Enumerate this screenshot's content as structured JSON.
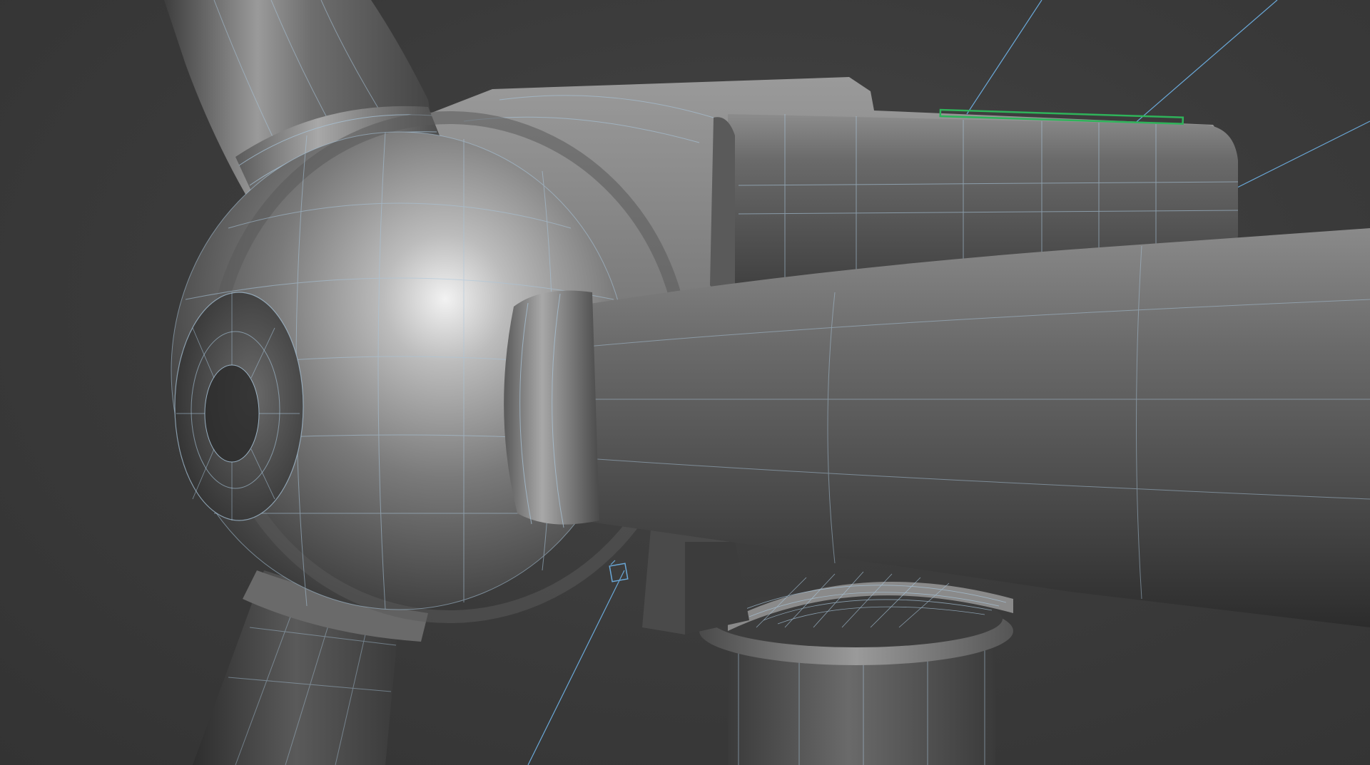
{
  "viewport": {
    "mode": "3d-perspective",
    "shading": "smooth-with-wireframe-edges",
    "background_color": "#3b3b3b",
    "wire_color": "#a9c6dc",
    "selection_color": "#2fb35a",
    "guide_color": "#6aa8d8"
  },
  "scene": {
    "subject": "wind-turbine",
    "objects": [
      "rotor-hub",
      "hub-nose-cap",
      "blade-upper",
      "blade-lower",
      "blade-right",
      "nacelle",
      "tower",
      "yaw-bearing",
      "selection-gizmo"
    ]
  }
}
